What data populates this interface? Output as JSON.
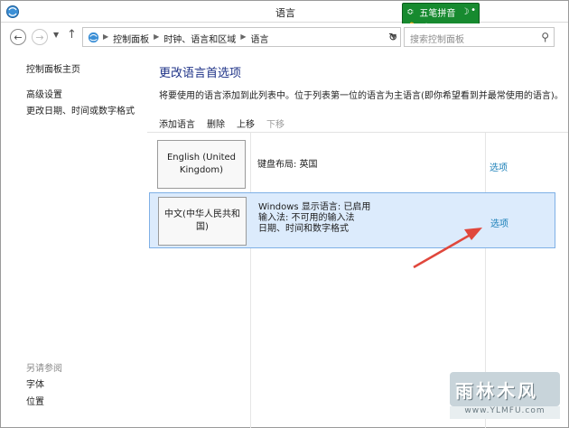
{
  "window": {
    "title": "语言"
  },
  "ime": {
    "name": "五笔拼音",
    "row2": "简"
  },
  "nav": {
    "breadcrumbs": [
      "控制面板",
      "时钟、语言和区域",
      "语言"
    ],
    "search_placeholder": "搜索控制面板"
  },
  "sidebar": {
    "items": [
      "控制面板主页",
      "高级设置",
      "更改日期、时间或数字格式"
    ],
    "see_also_title": "另请参阅",
    "see_also": [
      "字体",
      "位置"
    ]
  },
  "main": {
    "heading": "更改语言首选项",
    "description": "将要使用的语言添加到此列表中。位于列表第一位的语言为主语言(即你希望看到并最常使用的语言)。",
    "toolbar": [
      "添加语言",
      "删除",
      "上移",
      "下移"
    ],
    "languages": [
      {
        "name": "English (United Kingdom)",
        "info": [
          "键盘布局: 英国"
        ],
        "option": "选项"
      },
      {
        "name": "中文(中华人民共和国)",
        "info": [
          "Windows 显示语言: 已启用",
          "输入法: 不可用的输入法",
          "日期、时间和数字格式"
        ],
        "option": "选项"
      }
    ]
  },
  "watermark": {
    "text": "雨林木风",
    "url": "www.YLMFU.com"
  },
  "colors": {
    "accent_heading": "#1e3287",
    "link": "#1a7fb8",
    "selected_row": "#dcebfc",
    "arrow": "#e0473c",
    "ime": "#178a2f"
  }
}
